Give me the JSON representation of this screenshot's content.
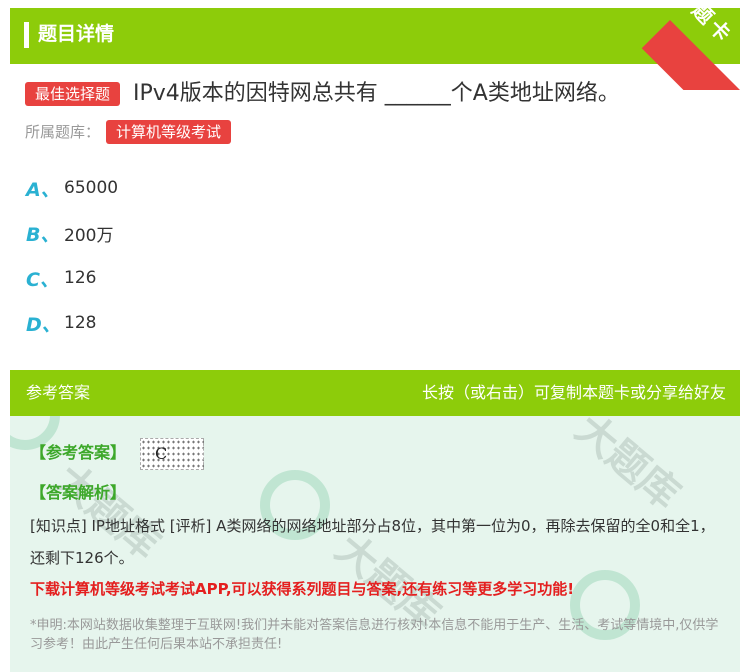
{
  "header": {
    "title": "题目详情",
    "corner_label": "题卡"
  },
  "question": {
    "type_badge": "最佳选择题",
    "text": "IPv4版本的因特网总共有 ______个A类地址网络。",
    "library_label": "所属题库：",
    "library_name": "计算机等级考试"
  },
  "options": [
    {
      "letter": "A、",
      "text": "65000"
    },
    {
      "letter": "B、",
      "text": "200万"
    },
    {
      "letter": "C、",
      "text": "126"
    },
    {
      "letter": "D、",
      "text": "128"
    }
  ],
  "answer_section": {
    "title": "参考答案",
    "hint": "长按（或右击）可复制本题卡或分享给好友",
    "ref_answer_label": "【参考答案】",
    "ref_answer_value": "C",
    "analysis_label": "【答案解析】",
    "analysis_text": "[知识点] IP地址格式 [评析] A类网络的网络地址部分占8位，其中第一位为0，再除去保留的全0和全1，还剩下126个。",
    "promo": "下载计算机等级考试考试APP,可以获得系列题目与答案,还有练习等更多学习功能!",
    "disclaimer": "*申明:本网站数据收集整理于互联网!我们并未能对答案信息进行核对!本信息不能用于生产、生活、考试等情境中,仅供学习参考！由此产生任何后果本站不承担责任!"
  },
  "colors": {
    "green": "#8dcc0a",
    "red": "#e8423f",
    "option_letter": "#2ab1d2",
    "answer_bg": "#e6f5ed"
  }
}
